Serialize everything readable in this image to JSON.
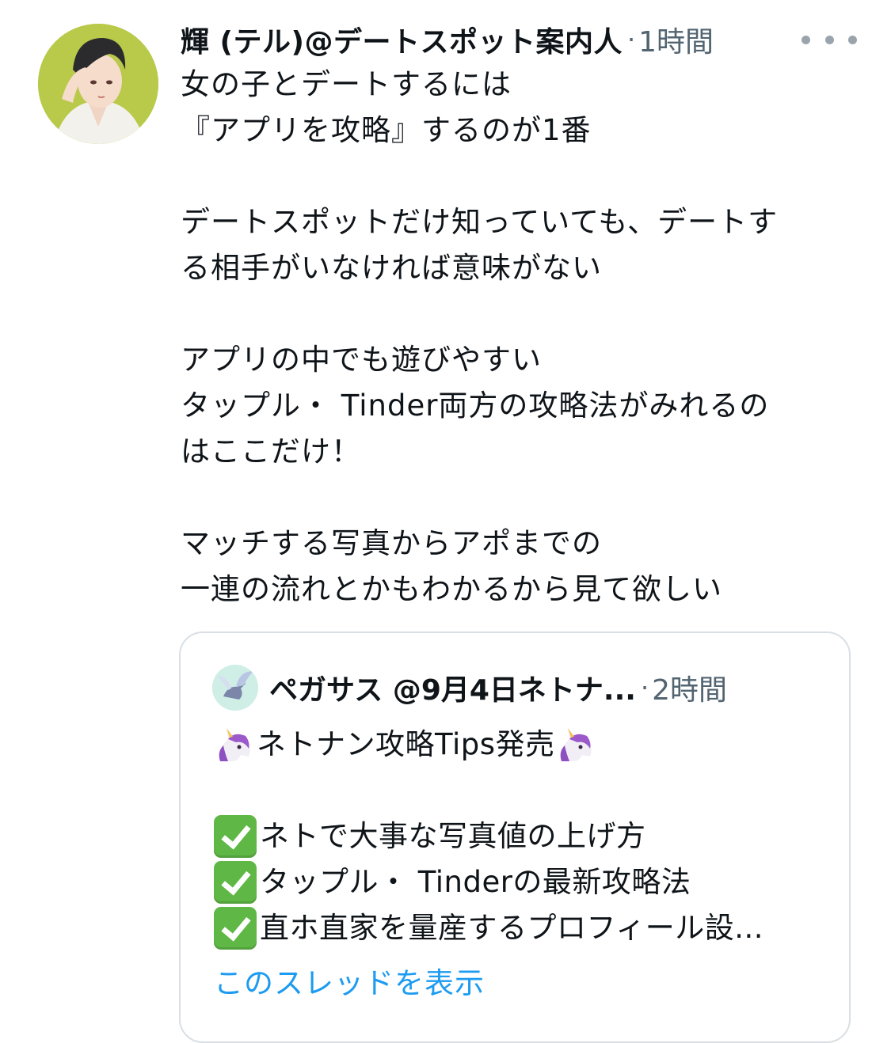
{
  "tweet": {
    "author_name": "輝 (テル)@デートスポット案内人",
    "separator": "·",
    "time": "1時間",
    "more_icon": "more-horizontal-icon",
    "lines": [
      "女の子とデートするには",
      "『アプリを攻略』するのが1番",
      "",
      "デートスポットだけ知っていても、デートす",
      "る相手がいなければ意味がない",
      "",
      "アプリの中でも遊びやすい",
      "タップル・ Tinder両方の攻略法がみれるの",
      "はここだけ！",
      "",
      "マッチする写真からアポまでの",
      "一連の流れとかもわかるから見て欲しい"
    ]
  },
  "quote": {
    "author_name": "ペガサス @9月4日ネトナ...",
    "separator": "·",
    "time": "2時間",
    "title_text": "ネトナン攻略Tips発売",
    "title_icon": "unicorn-emoji",
    "check_icon": "check-mark-button-emoji",
    "items": [
      "ネトで大事な写真値の上げ方",
      "タップル・ Tinderの最新攻略法",
      "直ホ直家を量産するプロフィール設..."
    ],
    "show_thread": "このスレッドを表示"
  },
  "colors": {
    "text": "#0f1419",
    "secondary": "#536471",
    "link": "#1d9bf0",
    "border": "#d9dfe4",
    "check_green": "#5fb845"
  }
}
